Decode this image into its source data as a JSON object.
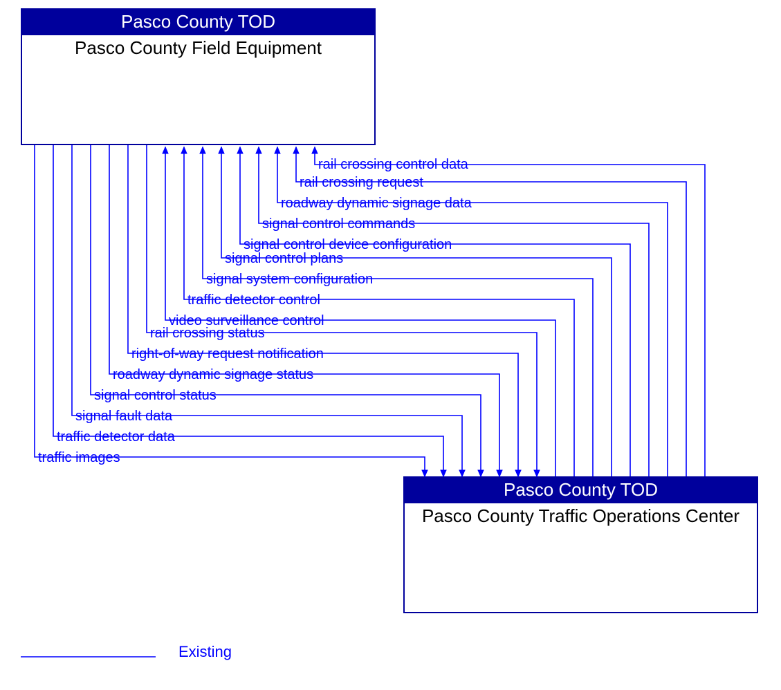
{
  "colors": {
    "header": "#00009c",
    "line": "#0000ff",
    "flow_text": "#0000ff",
    "legend_text": "#0000ff"
  },
  "box_a": {
    "header": "Pasco County TOD",
    "title": "Pasco County Field Equipment"
  },
  "box_b": {
    "header": "Pasco County TOD",
    "title": "Pasco County Traffic Operations Center"
  },
  "legend": "Existing",
  "flows": [
    {
      "label": "rail crossing control data",
      "direction": "to_a"
    },
    {
      "label": "rail crossing request",
      "direction": "to_a"
    },
    {
      "label": "roadway dynamic signage data",
      "direction": "to_a"
    },
    {
      "label": "signal control commands",
      "direction": "to_a"
    },
    {
      "label": "signal control device configuration",
      "direction": "to_a"
    },
    {
      "label": "signal control plans",
      "direction": "to_a"
    },
    {
      "label": "signal system configuration",
      "direction": "to_a"
    },
    {
      "label": "traffic detector control",
      "direction": "to_a"
    },
    {
      "label": "video surveillance control",
      "direction": "to_a"
    },
    {
      "label": "rail crossing status",
      "direction": "to_b"
    },
    {
      "label": "right-of-way request notification",
      "direction": "to_b"
    },
    {
      "label": "roadway dynamic signage status",
      "direction": "to_b"
    },
    {
      "label": "signal control status",
      "direction": "to_b"
    },
    {
      "label": "signal fault data",
      "direction": "to_b"
    },
    {
      "label": "traffic detector data",
      "direction": "to_b"
    },
    {
      "label": "traffic images",
      "direction": "to_b"
    }
  ],
  "chart_data": {
    "type": "diagram",
    "nodes": [
      {
        "id": "A",
        "group": "Pasco County TOD",
        "name": "Pasco County Field Equipment"
      },
      {
        "id": "B",
        "group": "Pasco County TOD",
        "name": "Pasco County Traffic Operations Center"
      }
    ],
    "edges": [
      {
        "from": "B",
        "to": "A",
        "label": "rail crossing control data",
        "status": "Existing"
      },
      {
        "from": "B",
        "to": "A",
        "label": "rail crossing request",
        "status": "Existing"
      },
      {
        "from": "B",
        "to": "A",
        "label": "roadway dynamic signage data",
        "status": "Existing"
      },
      {
        "from": "B",
        "to": "A",
        "label": "signal control commands",
        "status": "Existing"
      },
      {
        "from": "B",
        "to": "A",
        "label": "signal control device configuration",
        "status": "Existing"
      },
      {
        "from": "B",
        "to": "A",
        "label": "signal control plans",
        "status": "Existing"
      },
      {
        "from": "B",
        "to": "A",
        "label": "signal system configuration",
        "status": "Existing"
      },
      {
        "from": "B",
        "to": "A",
        "label": "traffic detector control",
        "status": "Existing"
      },
      {
        "from": "B",
        "to": "A",
        "label": "video surveillance control",
        "status": "Existing"
      },
      {
        "from": "A",
        "to": "B",
        "label": "rail crossing status",
        "status": "Existing"
      },
      {
        "from": "A",
        "to": "B",
        "label": "right-of-way request notification",
        "status": "Existing"
      },
      {
        "from": "A",
        "to": "B",
        "label": "roadway dynamic signage status",
        "status": "Existing"
      },
      {
        "from": "A",
        "to": "B",
        "label": "signal control status",
        "status": "Existing"
      },
      {
        "from": "A",
        "to": "B",
        "label": "signal fault data",
        "status": "Existing"
      },
      {
        "from": "A",
        "to": "B",
        "label": "traffic detector data",
        "status": "Existing"
      },
      {
        "from": "A",
        "to": "B",
        "label": "traffic images",
        "status": "Existing"
      }
    ],
    "legend": [
      {
        "label": "Existing",
        "style": "solid-blue"
      }
    ]
  }
}
